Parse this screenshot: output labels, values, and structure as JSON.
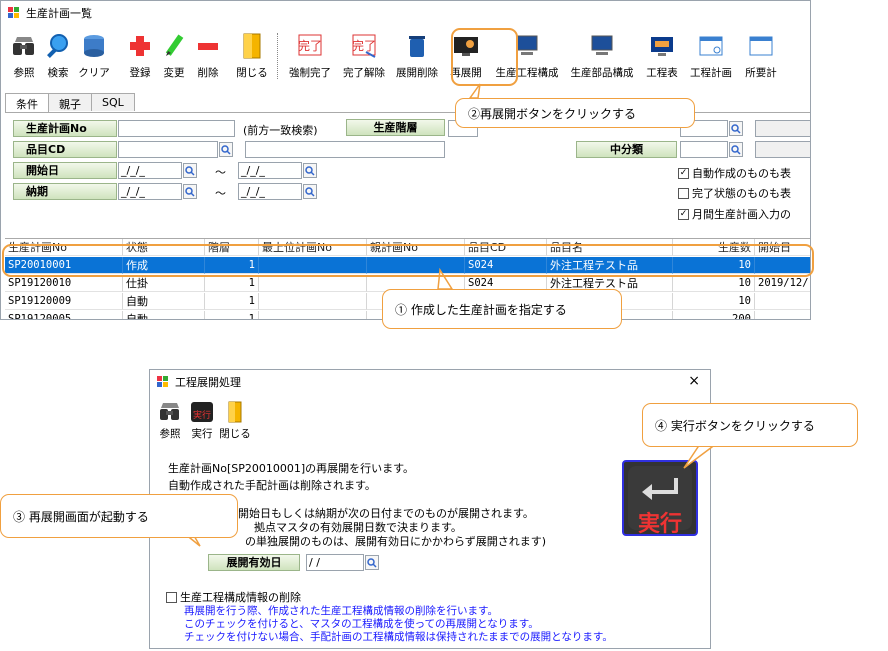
{
  "main_window": {
    "title": "生産計画一覧",
    "toolbar": [
      {
        "label": "参照",
        "icon": "binoculars-icon"
      },
      {
        "label": "検索",
        "icon": "magnifier-icon"
      },
      {
        "label": "クリア",
        "icon": "clear-icon"
      },
      {
        "label": "登録",
        "icon": "plus-icon"
      },
      {
        "label": "変更",
        "icon": "pencil-icon"
      },
      {
        "label": "削除",
        "icon": "minus-icon"
      },
      {
        "label": "閉じる",
        "icon": "door-icon"
      },
      {
        "label": "強制完了",
        "icon": "force-complete-icon"
      },
      {
        "label": "完了解除",
        "icon": "cancel-complete-icon"
      },
      {
        "label": "展開削除",
        "icon": "trash-icon"
      },
      {
        "label": "再展開",
        "icon": "re-expand-icon"
      },
      {
        "label": "生産工程構成",
        "icon": "computer-icon"
      },
      {
        "label": "生産部品構成",
        "icon": "computer-icon"
      },
      {
        "label": "工程表",
        "icon": "monitor-icon"
      },
      {
        "label": "工程計画",
        "icon": "window-icon"
      },
      {
        "label": "所要計",
        "icon": "window-icon"
      }
    ],
    "tabs": [
      "条件",
      "親子",
      "SQL"
    ],
    "conditions": {
      "plan_no_label": "生産計画No",
      "prefix_note": "(前方一致検索)",
      "level_label": "生産階層",
      "item_cd_label": "品目CD",
      "middle_class_label": "中分類",
      "start_date_label": "開始日",
      "due_date_label": "納期",
      "date_placeholder": "_/_/_",
      "tilde": "～",
      "checkboxes": [
        {
          "label": "自動作成のものも表",
          "checked": true
        },
        {
          "label": "完了状態のものも表",
          "checked": false
        },
        {
          "label": "月間生産計画入力の",
          "checked": true
        }
      ]
    },
    "grid": {
      "headers": [
        "生産計画No",
        "状態",
        "階層",
        "最上位計画No",
        "親計画No",
        "品目CD",
        "品目名",
        "生産数",
        "開始日"
      ],
      "rows": [
        [
          "SP20010001",
          "作成",
          "1",
          "",
          "",
          "S024",
          "外注工程テスト品",
          "10",
          ""
        ],
        [
          "SP19120010",
          "仕掛",
          "1",
          "",
          "",
          "S024",
          "外注工程テスト品",
          "10",
          "2019/12/"
        ],
        [
          "SP19120009",
          "自動",
          "1",
          "",
          "",
          "",
          "",
          "10",
          ""
        ],
        [
          "SP19120005",
          "自動",
          "1",
          "",
          "",
          "",
          "",
          "200",
          ""
        ]
      ]
    }
  },
  "dialog": {
    "title": "工程展開処理",
    "close": "×",
    "toolbar": [
      {
        "label": "参照",
        "icon": "binoculars-icon"
      },
      {
        "label": "実行",
        "icon": "execute-icon"
      },
      {
        "label": "閉じる",
        "icon": "door-icon"
      }
    ],
    "line1": "生産計画No[SP20010001]の再展開を行います。",
    "line2": "自動作成された手配計画は削除されます。",
    "line3": "開始日もしくは納期が次の日付までのものが展開されます。",
    "line4": "拠点マスタの有効展開日数で決まります。",
    "line5": "の単独展開のものは、展開有効日にかかわらず展開されます)",
    "effective_date_label": "展開有効日",
    "effective_date_value": " / /",
    "delete_checkbox_label": "生産工程構成情報の削除",
    "blue_notes": [
      "再展開を行う際、作成された生産工程構成情報の削除を行います。",
      "このチェックを付けると、マスタの工程構成を使っての再展開となります。",
      "チェックを付けない場合、手配計画の工程構成情報は保持されたままでの展開となります。"
    ],
    "big_execute_label": "実行"
  },
  "callouts": {
    "c1": "① 作成した生産計画を指定する",
    "c2": "②再展開ボタンをクリックする",
    "c3": "③ 再展開画面が起動する",
    "c4": "④ 実行ボタンをクリックする"
  },
  "colors": {
    "accent": "#f0a040",
    "selection": "#0a73d6",
    "label_green": "#cfe3bd",
    "note_blue": "#1a1aff"
  }
}
